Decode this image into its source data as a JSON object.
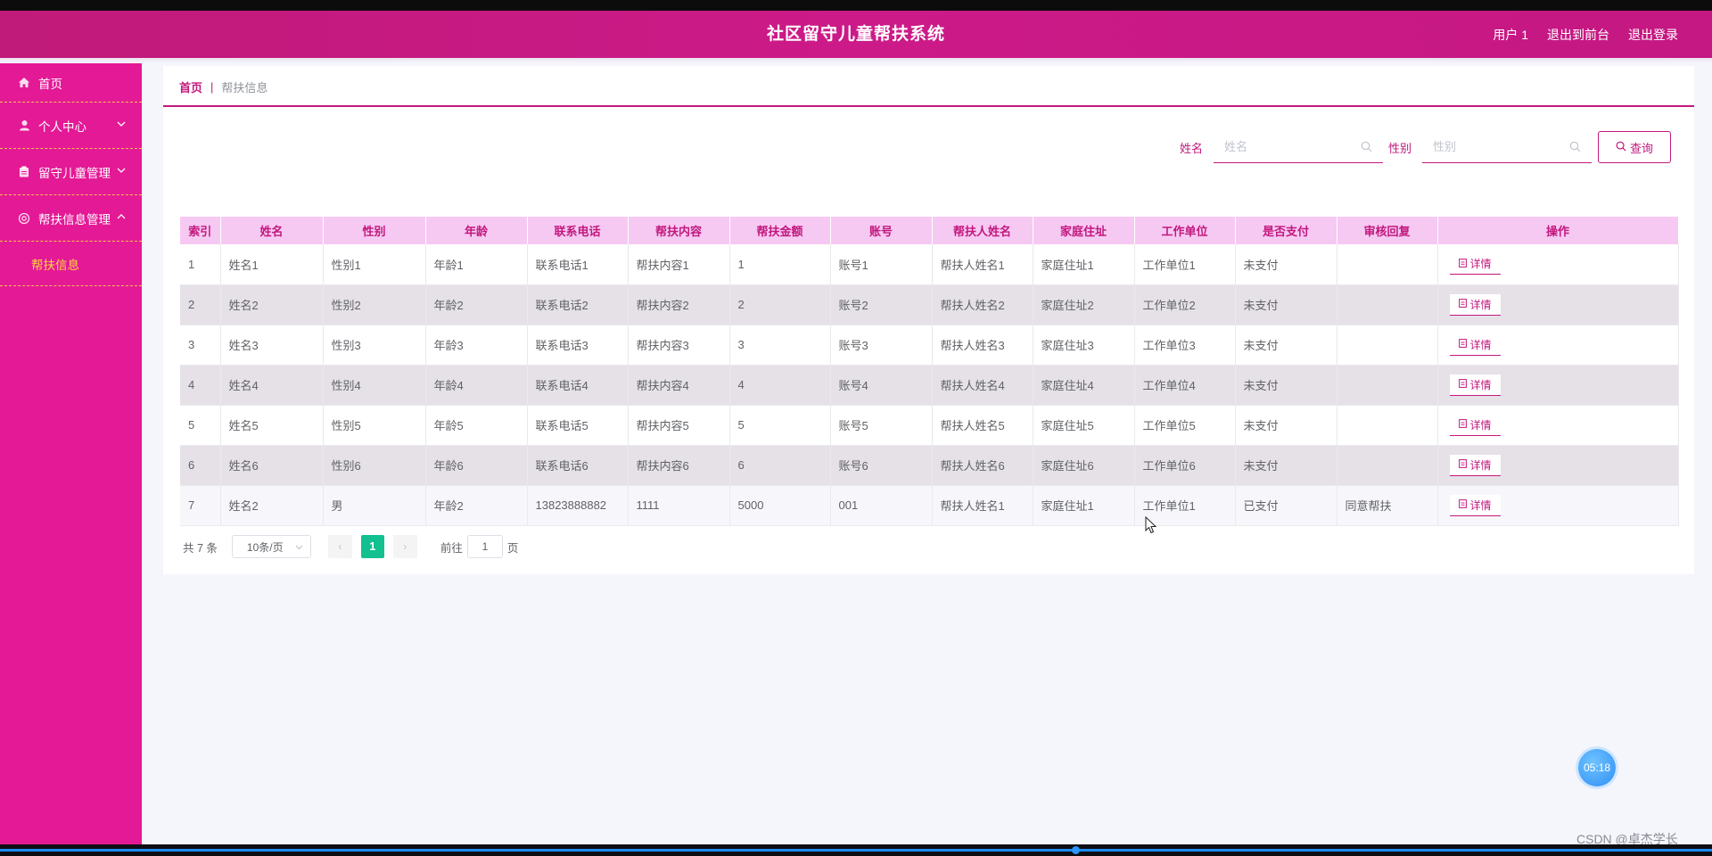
{
  "header": {
    "title": "社区留守儿童帮扶系统",
    "user_label": "用户 1",
    "back_front_label": "退出到前台",
    "logout_label": "退出登录",
    "color": "#cc1a88"
  },
  "sidebar": {
    "items": [
      {
        "label": "首页",
        "icon": "home-icon"
      },
      {
        "label": "个人中心",
        "icon": "user-icon",
        "arrow": "chevron-down"
      },
      {
        "label": "留守儿童管理",
        "icon": "clipboard-icon",
        "arrow": "chevron-down"
      },
      {
        "label": "帮扶信息管理",
        "icon": "settings-icon",
        "arrow": "chevron-up"
      }
    ],
    "submenu": {
      "label": "帮扶信息"
    },
    "color": "#e41996",
    "active_color": "#ffd640"
  },
  "breadcrumb": {
    "home": "首页",
    "separator": "|",
    "current": "帮扶信息"
  },
  "search": {
    "name_label": "姓名",
    "name_placeholder": "姓名",
    "gender_label": "性别",
    "gender_placeholder": "性别",
    "query_label": "查询"
  },
  "table": {
    "columns": [
      "索引",
      "姓名",
      "性别",
      "年龄",
      "联系电话",
      "帮扶内容",
      "帮扶金额",
      "账号",
      "帮扶人姓名",
      "家庭住址",
      "工作单位",
      "是否支付",
      "审核回复",
      "操作"
    ],
    "rows": [
      [
        "1",
        "姓名1",
        "性别1",
        "年龄1",
        "联系电话1",
        "帮扶内容1",
        "1",
        "账号1",
        "帮扶人姓名1",
        "家庭住址1",
        "工作单位1",
        "未支付",
        ""
      ],
      [
        "2",
        "姓名2",
        "性别2",
        "年龄2",
        "联系电话2",
        "帮扶内容2",
        "2",
        "账号2",
        "帮扶人姓名2",
        "家庭住址2",
        "工作单位2",
        "未支付",
        ""
      ],
      [
        "3",
        "姓名3",
        "性别3",
        "年龄3",
        "联系电话3",
        "帮扶内容3",
        "3",
        "账号3",
        "帮扶人姓名3",
        "家庭住址3",
        "工作单位3",
        "未支付",
        ""
      ],
      [
        "4",
        "姓名4",
        "性别4",
        "年龄4",
        "联系电话4",
        "帮扶内容4",
        "4",
        "账号4",
        "帮扶人姓名4",
        "家庭住址4",
        "工作单位4",
        "未支付",
        ""
      ],
      [
        "5",
        "姓名5",
        "性别5",
        "年龄5",
        "联系电话5",
        "帮扶内容5",
        "5",
        "账号5",
        "帮扶人姓名5",
        "家庭住址5",
        "工作单位5",
        "未支付",
        ""
      ],
      [
        "6",
        "姓名6",
        "性别6",
        "年龄6",
        "联系电话6",
        "帮扶内容6",
        "6",
        "账号6",
        "帮扶人姓名6",
        "家庭住址6",
        "工作单位6",
        "未支付",
        ""
      ],
      [
        "7",
        "姓名2",
        "男",
        "年龄2",
        "13823888882",
        "1111",
        "5000",
        "001",
        "帮扶人姓名1",
        "家庭住址1",
        "工作单位1",
        "已支付",
        "同意帮扶"
      ]
    ],
    "detail_label": "详情",
    "header_bg": "#f6c9f3",
    "accent": "#c2187d"
  },
  "pager": {
    "total": "共 7 条",
    "page_size": "10条/页",
    "current_page": "1",
    "goto_prefix": "前往",
    "goto_value": "1",
    "goto_suffix": "页",
    "active_color": "#13c08f"
  },
  "timer": "05:18",
  "watermark": "CSDN @卓杰学长"
}
